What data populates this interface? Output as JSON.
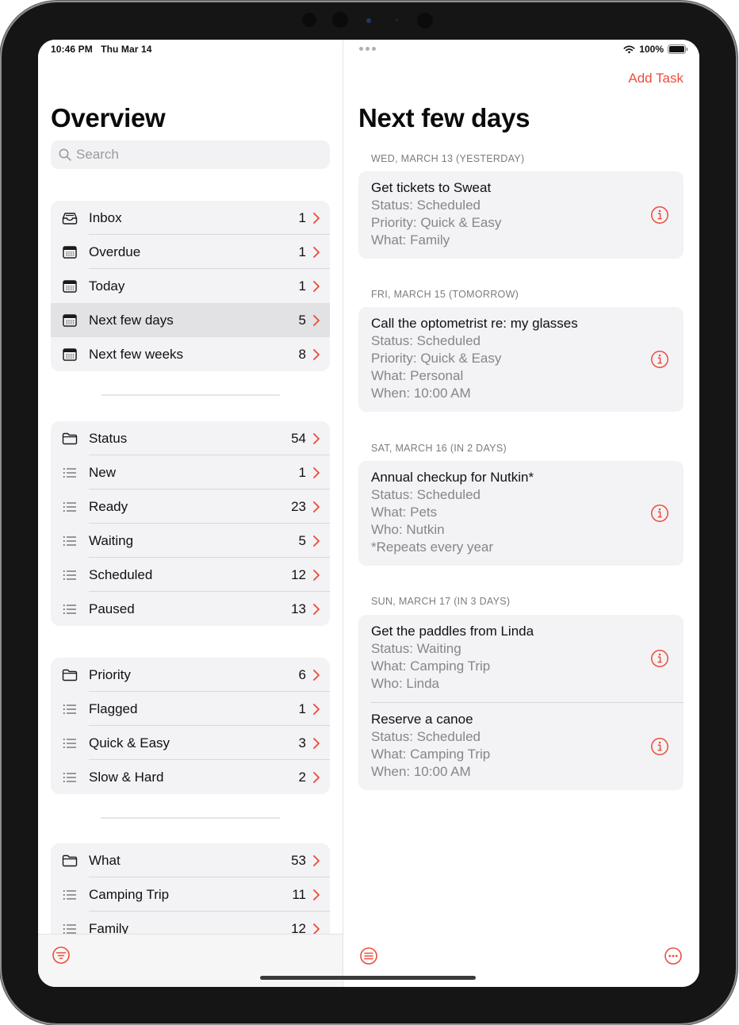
{
  "status_bar": {
    "time": "10:46 PM",
    "date": "Thu Mar 14",
    "battery": "100%"
  },
  "sidebar": {
    "title": "Overview",
    "search": {
      "placeholder": "Search",
      "value": ""
    },
    "groups": [
      {
        "items": [
          {
            "label": "Inbox",
            "count": "1",
            "icon": "tray-icon"
          },
          {
            "label": "Overdue",
            "count": "1",
            "icon": "calendar-icon"
          },
          {
            "label": "Today",
            "count": "1",
            "icon": "calendar-icon"
          },
          {
            "label": "Next few days",
            "count": "5",
            "icon": "calendar-icon",
            "selected": true
          },
          {
            "label": "Next few weeks",
            "count": "8",
            "icon": "calendar-icon"
          }
        ]
      },
      {
        "items": [
          {
            "label": "Status",
            "count": "54",
            "icon": "folder-icon"
          },
          {
            "label": "New",
            "count": "1",
            "icon": "list-icon"
          },
          {
            "label": "Ready",
            "count": "23",
            "icon": "list-icon"
          },
          {
            "label": "Waiting",
            "count": "5",
            "icon": "list-icon"
          },
          {
            "label": "Scheduled",
            "count": "12",
            "icon": "list-icon"
          },
          {
            "label": "Paused",
            "count": "13",
            "icon": "list-icon"
          }
        ]
      },
      {
        "items": [
          {
            "label": "Priority",
            "count": "6",
            "icon": "folder-icon"
          },
          {
            "label": "Flagged",
            "count": "1",
            "icon": "list-icon"
          },
          {
            "label": "Quick & Easy",
            "count": "3",
            "icon": "list-icon"
          },
          {
            "label": "Slow & Hard",
            "count": "2",
            "icon": "list-icon"
          }
        ]
      },
      {
        "items": [
          {
            "label": "What",
            "count": "53",
            "icon": "folder-icon"
          },
          {
            "label": "Camping Trip",
            "count": "11",
            "icon": "list-icon"
          },
          {
            "label": "Family",
            "count": "12",
            "icon": "list-icon"
          }
        ]
      }
    ]
  },
  "detail": {
    "add_task_label": "Add Task",
    "title": "Next few days",
    "sections": [
      {
        "header": "WED, MARCH 13 (YESTERDAY)",
        "tasks": [
          {
            "title": "Get tickets to Sweat",
            "details": [
              "Status: Scheduled",
              "Priority: Quick & Easy",
              "What: Family"
            ]
          }
        ]
      },
      {
        "header": "FRI, MARCH 15 (TOMORROW)",
        "tasks": [
          {
            "title": "Call the optometrist re: my glasses",
            "details": [
              "Status: Scheduled",
              "Priority: Quick & Easy",
              "What: Personal",
              "When: 10:00 AM"
            ]
          }
        ]
      },
      {
        "header": "SAT, MARCH 16 (IN 2 DAYS)",
        "tasks": [
          {
            "title": "Annual checkup for Nutkin*",
            "details": [
              "Status: Scheduled",
              "What: Pets",
              "Who: Nutkin",
              "*Repeats every year"
            ]
          }
        ]
      },
      {
        "header": "SUN, MARCH 17 (IN 3 DAYS)",
        "tasks": [
          {
            "title": "Get the paddles from Linda",
            "details": [
              "Status: Waiting",
              "What: Camping Trip",
              "Who: Linda"
            ]
          },
          {
            "title": "Reserve a canoe",
            "details": [
              "Status: Scheduled",
              "What: Camping Trip",
              "When: 10:00 AM"
            ]
          }
        ]
      }
    ]
  },
  "colors": {
    "accent": "#eb4d3d",
    "group_bg": "#f3f2f4",
    "selected_bg": "#e2e1e4",
    "secondary_text": "#86868b"
  }
}
